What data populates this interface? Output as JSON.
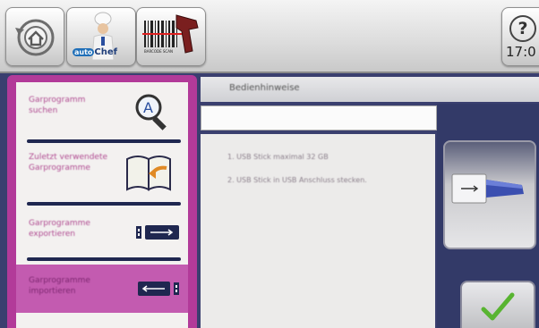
{
  "toolbar": {
    "back_button": "home-back",
    "chef_logo": {
      "prefix": "auto",
      "suffix": "Chef"
    },
    "barcode_label": "BARCODE SCAN",
    "help_label": "?",
    "clock": "17:0"
  },
  "sidebar": {
    "items": [
      {
        "label": "Garprogramm suchen",
        "icon": "magnifier-icon",
        "selected": false
      },
      {
        "label": "Zuletzt verwendete Garprogramme",
        "icon": "book-icon",
        "selected": false
      },
      {
        "label": "Garprogramme exportieren",
        "icon": "usb-export-icon",
        "selected": false
      },
      {
        "label": "Garprogramme importieren",
        "icon": "usb-import-icon",
        "selected": true
      }
    ]
  },
  "main": {
    "header": "Bedienhinweise",
    "instructions": [
      "1. USB Stick maximal 32 GB",
      "2. USB Stick in USB Anschluss stecken."
    ]
  },
  "colors": {
    "accent": "#b23a99",
    "background": "#3a3f6f",
    "confirm": "#58b431"
  }
}
